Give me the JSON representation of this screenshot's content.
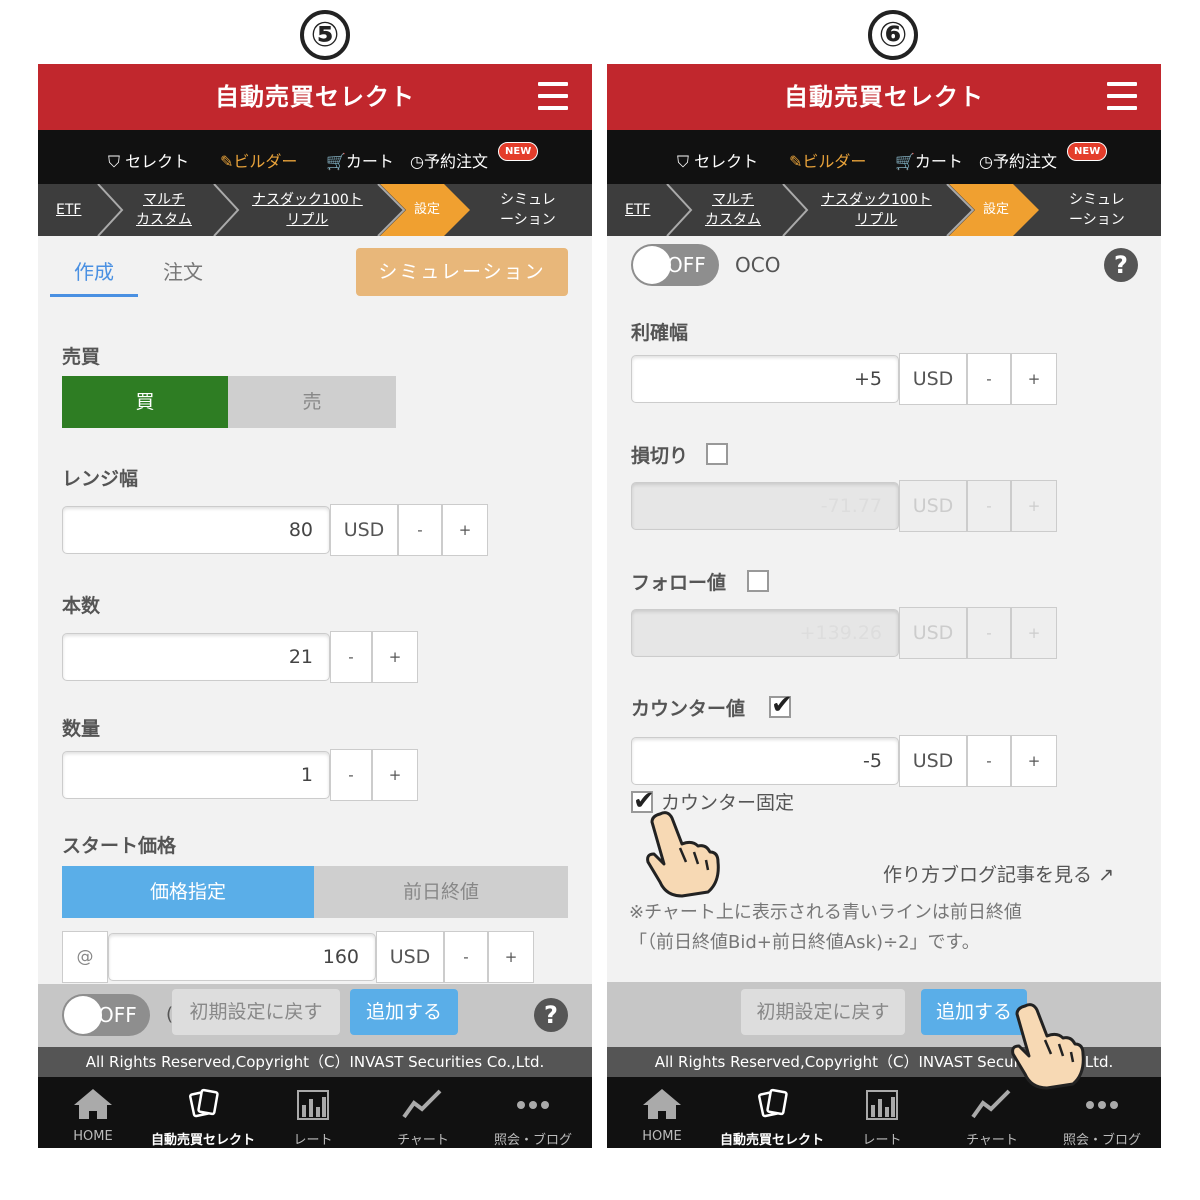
{
  "steps": [
    "⑤",
    "⑥"
  ],
  "app": {
    "title": "自動売買セレクト",
    "nav": {
      "select": "セレクト",
      "builder": "ビルダー",
      "cart": "カート",
      "reserve": "予約注文",
      "new_badge": "NEW"
    },
    "breadcrumb": {
      "etf": "ETF",
      "multi_1": "マルチ",
      "multi_2": "カスタム",
      "nasdaq_1": "ナスダック100ト",
      "nasdaq_2": "リプル",
      "settings": "設定",
      "sim_1": "シミュレ",
      "sim_2": "ーション"
    },
    "footer": "All Rights Reserved,Copyright（C）INVAST Securities Co.,Ltd.",
    "tabs": [
      "HOME",
      "自動売買セレクト",
      "レート",
      "チャート",
      "照会・ブログ"
    ],
    "colors": {
      "header": "#c1272d",
      "buy": "#2e7d23",
      "accent": "#4a90e2",
      "orange": "#f0a030"
    }
  },
  "left": {
    "tab_create": "作成",
    "tab_order": "注文",
    "sim_button": "シミュレーション",
    "side_label": "売買",
    "buy": "買",
    "sell": "売",
    "range_label": "レンジ幅",
    "range_value": "80",
    "count_label": "本数",
    "count_value": "21",
    "qty_label": "数量",
    "qty_value": "1",
    "start_label": "スタート価格",
    "price_spec": "価格指定",
    "prev_close": "前日終値",
    "at": "@",
    "start_value": "160",
    "unit": "USD",
    "minus": "-",
    "plus": "+",
    "toggle": "OFF",
    "reset": "初期設定に戻す",
    "add": "追加する",
    "help": "?"
  },
  "right": {
    "toggle": "OFF",
    "oco": "OCO",
    "help": "?",
    "tp_label": "利確幅",
    "tp_value": "+5",
    "sl_label": "損切り",
    "sl_value": "-71.77",
    "follow_label": "フォロー値",
    "follow_value": "+139.26",
    "counter_label": "カウンター値",
    "counter_value": "-5",
    "counter_fixed": "カウンター固定",
    "blog_link": "作り方ブログ記事を見る",
    "note_1": "※チャート上に表示される青いラインは前日終値",
    "note_2": "「（前日終値Bid+前日終値Ask)÷2」です。",
    "unit": "USD",
    "minus": "-",
    "plus": "+",
    "reset": "初期設定に戻す",
    "add": "追加する"
  }
}
